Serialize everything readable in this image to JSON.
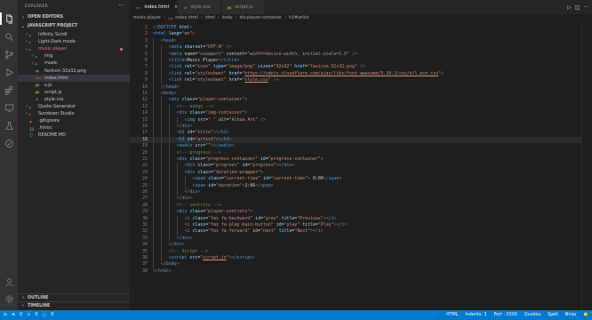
{
  "sidebar": {
    "title": "EXPLORER",
    "more_icon": "ellipsis-icon",
    "open_editors_label": "OPEN EDITORS",
    "project_label": "JAVASCRIPT PROJECT",
    "tree": [
      {
        "label": "Infinity Scroll",
        "type": "folder",
        "expanded": false
      },
      {
        "label": "Light-Dark mode",
        "type": "folder",
        "expanded": false
      },
      {
        "label": "music-player",
        "type": "folder",
        "expanded": true,
        "color": "#e2708f"
      },
      {
        "label": "img",
        "type": "folder",
        "expanded": false
      },
      {
        "label": "music",
        "type": "folder",
        "expanded": false
      },
      {
        "label": "favicon-32x32.png",
        "type": "image"
      },
      {
        "label": "index.html",
        "type": "html",
        "selected": true
      },
      {
        "label": "s.js",
        "type": "js"
      },
      {
        "label": "script.js",
        "type": "js"
      },
      {
        "label": "style.css",
        "type": "css"
      },
      {
        "label": "Quote Generator",
        "type": "folder",
        "expanded": false
      },
      {
        "label": "Sundown Studio",
        "type": "folder",
        "expanded": false
      },
      {
        "label": ".gitignore",
        "type": "git"
      },
      {
        "label": ".hintrc",
        "type": "config"
      },
      {
        "label": "README.MD",
        "type": "md"
      }
    ],
    "outline_label": "OUTLINE",
    "timeline_label": "TIMELINE"
  },
  "tabs": [
    {
      "label": "index.html",
      "badge": "<>",
      "active": true,
      "color": "#e37933"
    },
    {
      "label": "style.css",
      "badge": "#",
      "active": false,
      "color": "#519aba"
    },
    {
      "label": "script.js",
      "badge": "JS",
      "active": false,
      "color": "#cbcb41"
    }
  ],
  "breadcrumb": [
    "music-player",
    "index.html",
    "html",
    "body",
    "div.player-container",
    "h3#artist"
  ],
  "current_line": 18,
  "status": {
    "errors": "0",
    "warnings": "0",
    "info": "0",
    "language": "HTML",
    "indent": "Indents: 3",
    "port": "Port : 5500",
    "quokka": "Quokka",
    "spell": "Spell",
    "ninja": "Ninja"
  },
  "colors": {
    "accent": "#007acc",
    "editor_bg": "#1e1e1e",
    "sidebar_bg": "#252526",
    "activity_bg": "#333333"
  }
}
